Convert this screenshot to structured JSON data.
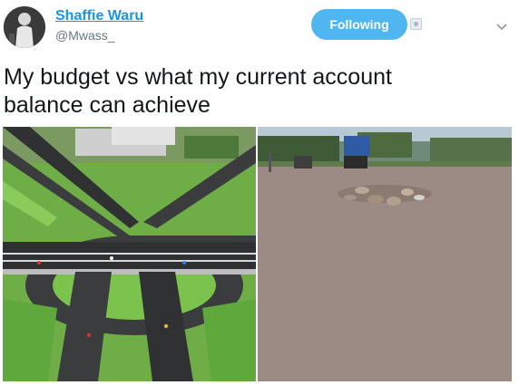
{
  "user": {
    "display_name": "Shaffie Waru",
    "handle": "@Mwass_"
  },
  "actions": {
    "follow_label": "Following"
  },
  "tweet": {
    "text": "My budget vs what my current account\nbalance can achieve"
  },
  "icons": {
    "avatar": "user-avatar-photo",
    "follow_state": "user-icon",
    "menu": "chevron-down-icon"
  },
  "colors": {
    "link": "#1b95e0",
    "follow_button": "#50b6f0",
    "muted": "#657786"
  }
}
